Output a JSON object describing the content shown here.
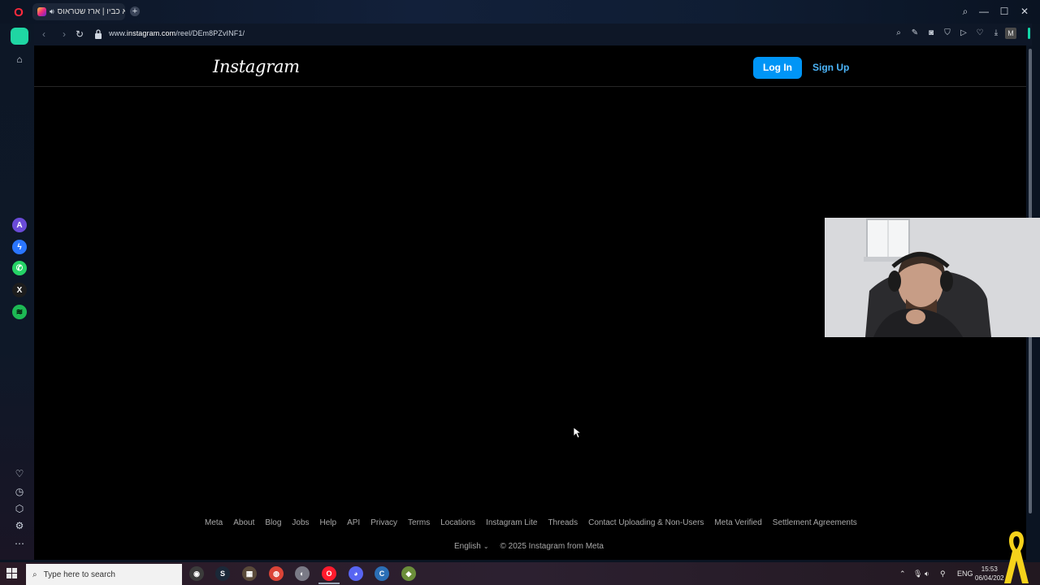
{
  "browser": {
    "tab": {
      "title": "הלא כביו | ארז שטראוס",
      "audio_icon": "speaker-icon"
    },
    "new_tab_label": "+",
    "window_controls": {
      "search": "⌕",
      "minimize": "—",
      "maximize": "☐",
      "close": "✕"
    },
    "url": {
      "prefix": "www.",
      "host": "instagram.com",
      "path": "/reel/DEm8PZvINF1/"
    },
    "profile_initial": "M",
    "accent_color": "#12d6a8"
  },
  "instagram": {
    "logo": "Instagram",
    "login_label": "Log In",
    "signup_label": "Sign Up",
    "footer_links": [
      "Meta",
      "About",
      "Blog",
      "Jobs",
      "Help",
      "API",
      "Privacy",
      "Terms",
      "Locations",
      "Instagram Lite",
      "Threads",
      "Contact Uploading & Non-Users",
      "Meta Verified",
      "Settlement Agreements"
    ],
    "language": "English",
    "copyright": "© 2025 Instagram from Meta",
    "login_color": "#0095f6",
    "signup_color": "#4cb5f9"
  },
  "taskbar": {
    "search_placeholder": "Type here to search",
    "language": "ENG",
    "time": "15:53",
    "date": "06/04/202"
  }
}
